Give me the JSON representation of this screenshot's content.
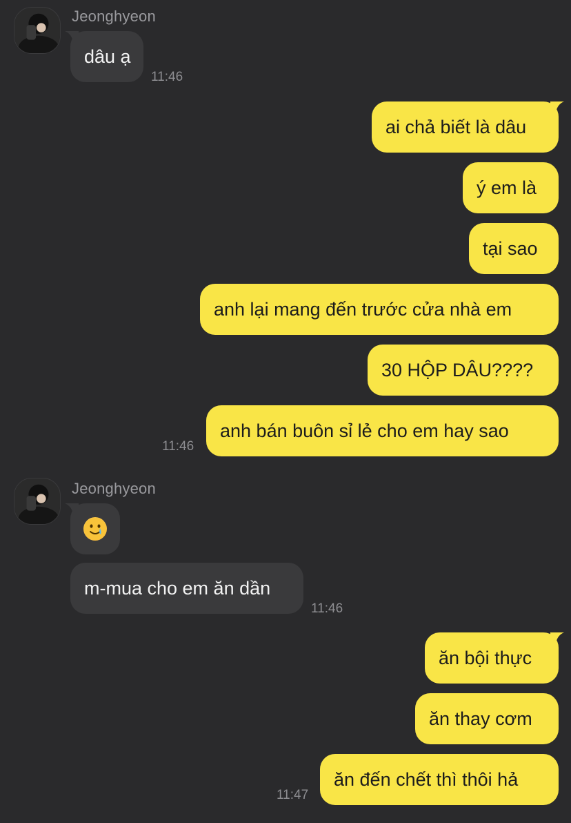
{
  "colors": {
    "background": "#2a2a2c",
    "incoming_bubble": "#3a3a3c",
    "outgoing_bubble": "#f9e547",
    "timestamp": "#8d8d91",
    "sender_name": "#9a9a9e"
  },
  "groups": [
    {
      "direction": "incoming",
      "sender": "Jeonghyeon",
      "messages": [
        {
          "text": "dâu ạ"
        }
      ],
      "time": "11:46"
    },
    {
      "direction": "outgoing",
      "messages": [
        {
          "text": "ai chả biết là dâu"
        },
        {
          "text": "ý em là"
        },
        {
          "text": "tại sao"
        },
        {
          "text": "anh lại mang đến trước cửa nhà em"
        },
        {
          "text": "30 HỘP DÂU????"
        },
        {
          "text": "anh bán buôn sỉ lẻ cho em hay sao"
        }
      ],
      "time": "11:46"
    },
    {
      "direction": "incoming",
      "sender": "Jeonghyeon",
      "messages": [
        {
          "emoji": "crying-smile-emoji"
        },
        {
          "text": "m-mua cho em ăn dần"
        }
      ],
      "time": "11:46"
    },
    {
      "direction": "outgoing",
      "messages": [
        {
          "text": "ăn bội thực"
        },
        {
          "text": "ăn thay cơm"
        },
        {
          "text": "ăn đến chết thì thôi hả"
        }
      ],
      "time": "11:47"
    }
  ]
}
